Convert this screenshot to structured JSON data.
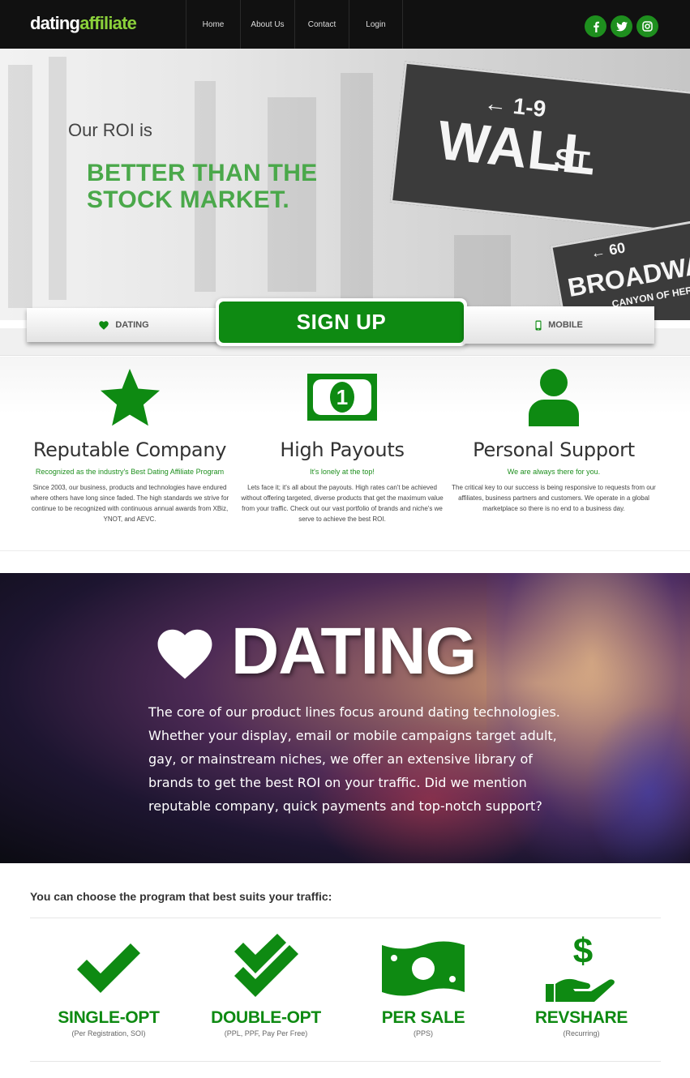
{
  "nav": {
    "logo_part1": "dating",
    "logo_part2": "affiliate",
    "links": [
      "Home",
      "About Us",
      "Contact",
      "Login"
    ],
    "social_icons": [
      "facebook-icon",
      "twitter-icon",
      "instagram-icon"
    ]
  },
  "hero": {
    "subtitle": "Our ROI is",
    "title_line1": "BETTER THAN THE",
    "title_line2": "STOCK MARKET.",
    "sign_arrow": "← 1-9",
    "sign_main": "WALL",
    "sign_st": "ST",
    "sign2_arrow": "← 60",
    "sign2_main": "BROADWAY",
    "sign2_sub": "CANYON OF HEROES"
  },
  "tabs": {
    "dating": "DATING",
    "signup": "SIGN UP",
    "mobile": "MOBILE"
  },
  "features": [
    {
      "title": "Reputable Company",
      "tag": "Recognized as the industry's Best Dating Affiliate Program",
      "body": "Since 2003, our business, products and technologies have endured where others have long since faded. The high standards we strive for continue to be recognized with continuous annual awards from XBiz, YNOT, and AEVC."
    },
    {
      "title": "High Payouts",
      "tag": "It's lonely at the top!",
      "body": "Lets face it; it's all about the payouts. High rates can't be achieved without offering targeted, diverse products that get the maximum value from your traffic. Check out our vast portfolio of brands and niche's we serve to achieve the best ROI."
    },
    {
      "title": "Personal Support",
      "tag": "We are always there for you.",
      "body": "The critical key to our success is being responsive to requests from our affiliates, business partners and customers. We operate in a global marketplace so there is no end to a business day."
    }
  ],
  "dating": {
    "title": "DATING",
    "body": "The core of our product lines focus around dating technologies. Whether your display, email or mobile campaigns target adult, gay, or mainstream niches, we offer an extensive library of brands to get the best ROI on your traffic. Did we mention reputable company, quick payments and top-notch support?"
  },
  "programs": {
    "heading": "You can choose the program that best suits your traffic:",
    "items": [
      {
        "title": "SINGLE-OPT",
        "sub": "(Per Registration, SOI)"
      },
      {
        "title": "DOUBLE-OPT",
        "sub": "(PPL, PPF, Pay Per Free)"
      },
      {
        "title": "PER SALE",
        "sub": "(PPS)"
      },
      {
        "title": "REVSHARE",
        "sub": "(Recurring)"
      }
    ]
  },
  "colors": {
    "brand_green": "#0e8a12",
    "light_green": "#4aa84a",
    "nav_bg": "#111111"
  }
}
